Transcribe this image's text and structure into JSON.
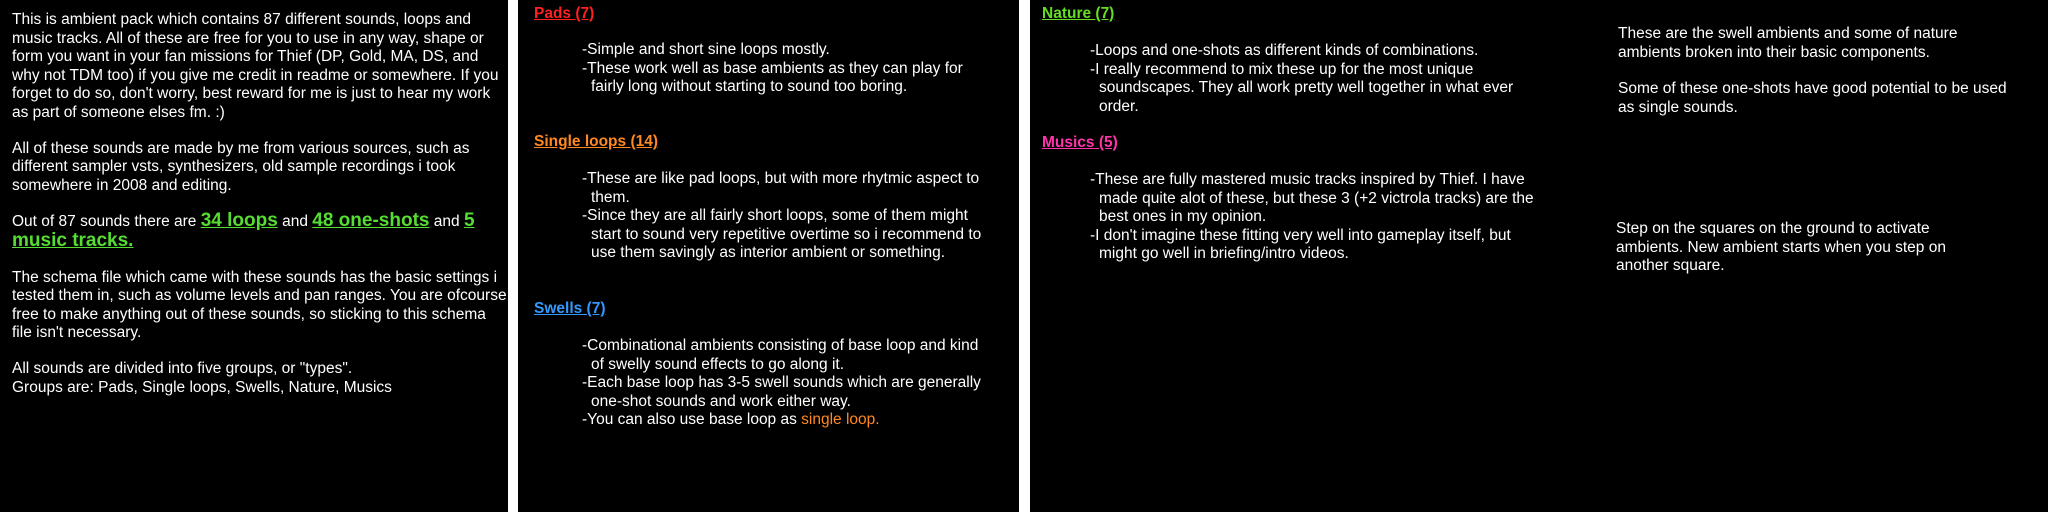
{
  "intro": {
    "para1": "This is ambient pack which contains 87 different sounds, loops and music tracks. All of these are free for you to use in any way, shape or form you want in your fan missions for Thief (DP, Gold, MA, DS, and why not TDM too) if you give me credit in readme or somewhere. If you forget to do so, don't worry, best reward for me is just to hear my work as part of someone elses fm. :)",
    "para2": "All of these sounds are made by me from various sources, such as different sampler vsts, synthesizers, old sample recordings i took somewhere in 2008 and editing.",
    "para3_prefix": "Out of 87 sounds there are ",
    "loops": "34 loops",
    "and1": " and ",
    "oneshots": "48 one-shots",
    "and2": " and ",
    "music": "5 music tracks.",
    "para4": "The schema file which came with these sounds has the basic settings i tested them in, such as volume levels and pan ranges. You are ofcourse free to make anything out of these sounds, so sticking to this schema file isn't necessary.",
    "para5_line1": "All sounds are divided into five groups, or \"types\".",
    "para5_line2": "Groups are: Pads, Single loops, Swells, Nature, Musics"
  },
  "groups": {
    "pads": {
      "title": "Pads (7)",
      "color": "#ff2020",
      "items": [
        "-Simple and short sine loops mostly.",
        "-These work well as base ambients as they can play for fairly long without starting to sound too boring."
      ]
    },
    "single_loops": {
      "title": "Single loops (14)",
      "color": "#ff8820",
      "items": [
        "-These are like pad loops, but with more rhytmic aspect to them.",
        "-Since they are all fairly short loops, some of them might start to sound very repetitive overtime so i recommend to use them savingly as interior ambient or something."
      ]
    },
    "swells": {
      "title": "Swells (7)",
      "color": "#3399ff",
      "items": [
        "-Combinational ambients consisting of base loop and kind of swelly sound effects to go along it.",
        "-Each base loop has 3-5 swell sounds which are generally one-shot sounds and work either way."
      ],
      "last_prefix": "-You can also use base loop as ",
      "last_highlight": "single loop."
    },
    "nature": {
      "title": "Nature (7)",
      "color": "#66dd22",
      "items": [
        "-Loops and one-shots as different kinds of combinations.",
        "-I really recommend to mix these up for the most unique soundscapes. They all work pretty well together in what ever order."
      ]
    },
    "musics": {
      "title": "Musics (5)",
      "color": "#ff33aa",
      "items": [
        "-These are fully mastered music tracks inspired by Thief. I have made quite alot of these, but these 3 (+2 victrola tracks) are the best ones in my opinion.",
        "-I don't imagine these fitting very well into gameplay itself, but might go well in briefing/intro videos."
      ]
    }
  },
  "notes": {
    "swell_note": "These are the swell ambients and some of nature ambients broken into their basic components.",
    "oneshot_note": "Some of these one-shots have good potential to be used as single sounds.",
    "step_note": "Step on the squares on the ground to activate ambients. New ambient starts when you step on another square."
  }
}
